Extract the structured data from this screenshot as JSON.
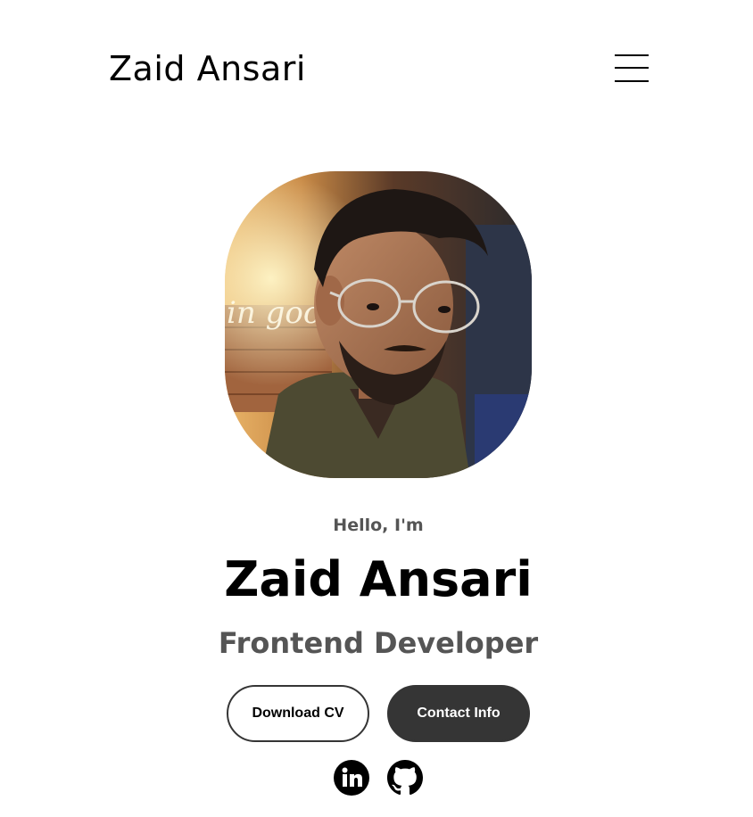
{
  "nav": {
    "logo": "Zaid Ansari",
    "menu_icon": "hamburger-menu-icon"
  },
  "profile": {
    "image_alt": "Profile picture",
    "greeting": "Hello, I'm",
    "name": "Zaid Ansari",
    "role": "Frontend Developer"
  },
  "buttons": {
    "download_cv": "Download CV",
    "contact_info": "Contact Info"
  },
  "socials": [
    {
      "icon": "linkedin-icon",
      "label": "in"
    },
    {
      "icon": "github-icon"
    }
  ],
  "colors": {
    "primary_text": "#000000",
    "secondary_text": "#555555",
    "button_dark": "#353535",
    "background": "#ffffff"
  }
}
